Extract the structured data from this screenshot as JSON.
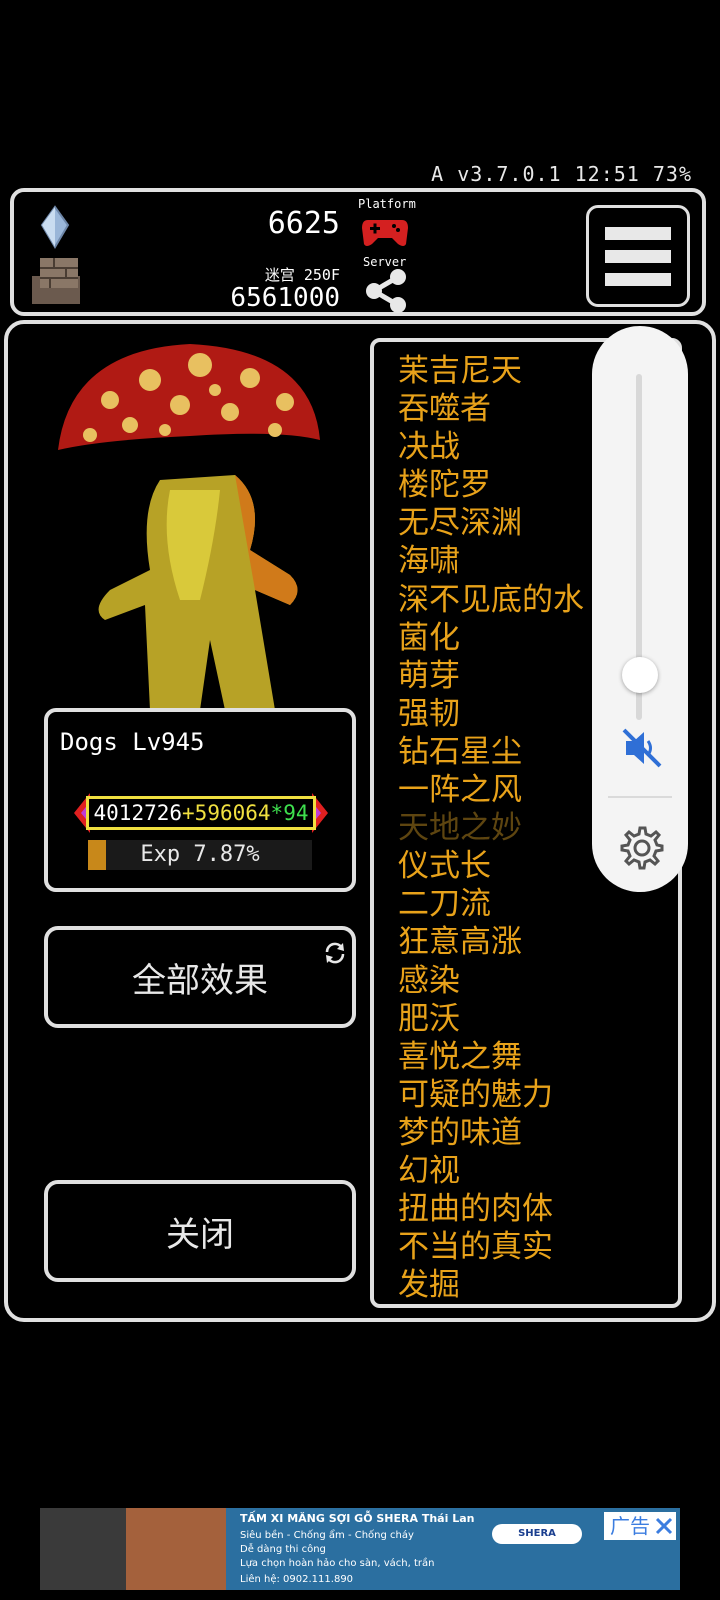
{
  "status_bar": {
    "text": "A v3.7.0.1 12:51 73%"
  },
  "resources": {
    "gems": "6625",
    "maze_label": "迷宫 250F",
    "maze_value": "6561000",
    "platform_label": "Platform",
    "server_label": "Server"
  },
  "monster": {
    "name": "Dogs Lv945",
    "hp_base": "4012726",
    "hp_plus": "+596064",
    "hp_mult": "*94",
    "exp_text": "Exp 7.87%",
    "exp_percent": 7.87
  },
  "buttons": {
    "all_effects": "全部效果",
    "close": "关闭"
  },
  "effects": [
    "苿吉尼天",
    "吞噬者",
    "决战",
    "楼陀罗",
    "无尽深渊",
    "海啸",
    "深不见底的水",
    "菌化",
    "萌芽",
    "强韧",
    "钻石星尘",
    "一阵之风",
    "天地之妙",
    "仪式长",
    "二刀流",
    "狂意高涨",
    "感染",
    "肥沃",
    "喜悦之舞",
    "可疑的魅力",
    "梦的味道",
    "幻视",
    "扭曲的肉体",
    "不当的真实",
    "发掘"
  ],
  "volume": {
    "level": 0.13,
    "muted": true
  },
  "ad": {
    "title": "TẤM XI MĂNG SỢI GỖ SHERA Thái Lan",
    "line1": "Siêu bền - Chống ẩm - Chống cháy",
    "line2": "Dễ dàng thi công",
    "line3": "Lựa chọn hoàn hảo cho sàn, vách, trần",
    "phone": "Liên hệ: 0902.111.890",
    "logo": "SHERA",
    "badge": "广告"
  },
  "colors": {
    "effect_text": "#e8a21a",
    "effect_dim": "#5e4510",
    "hp_plus": "#f0e040",
    "hp_mult": "#3ee04e",
    "mute_blue": "#2f6fd6"
  }
}
